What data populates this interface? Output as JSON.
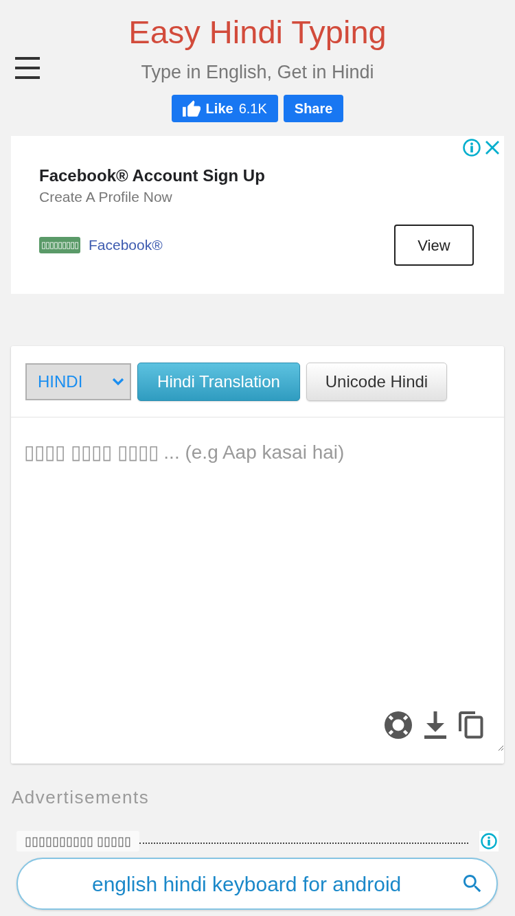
{
  "header": {
    "title": "Easy Hindi Typing",
    "subtitle": "Type in English, Get in Hindi",
    "like_button": {
      "label": "Like",
      "count": "6.1K"
    },
    "share_button": {
      "label": "Share"
    }
  },
  "ad": {
    "title": "Facebook® Account Sign Up",
    "description": "Create A Profile Now",
    "badge": "▯▯▯▯▯▯▯▯▯",
    "advertiser": "Facebook®",
    "button": "View"
  },
  "editor": {
    "language_select": {
      "value": "HINDI"
    },
    "buttons": [
      {
        "label": "Hindi Translation",
        "selected": true
      },
      {
        "label": "Unicode Hindi",
        "selected": false
      }
    ],
    "text_area": {
      "placeholder": "▯▯▯▯ ▯▯▯▯ ▯▯▯▯ ... (e.g Aap kasai hai)"
    }
  },
  "advertisements": {
    "heading": "Advertisements",
    "related_search": {
      "label": "▯▯▯▯▯▯▯▯▯▯ ▯▯▯▯▯",
      "query": "english hindi keyboard for android"
    }
  }
}
